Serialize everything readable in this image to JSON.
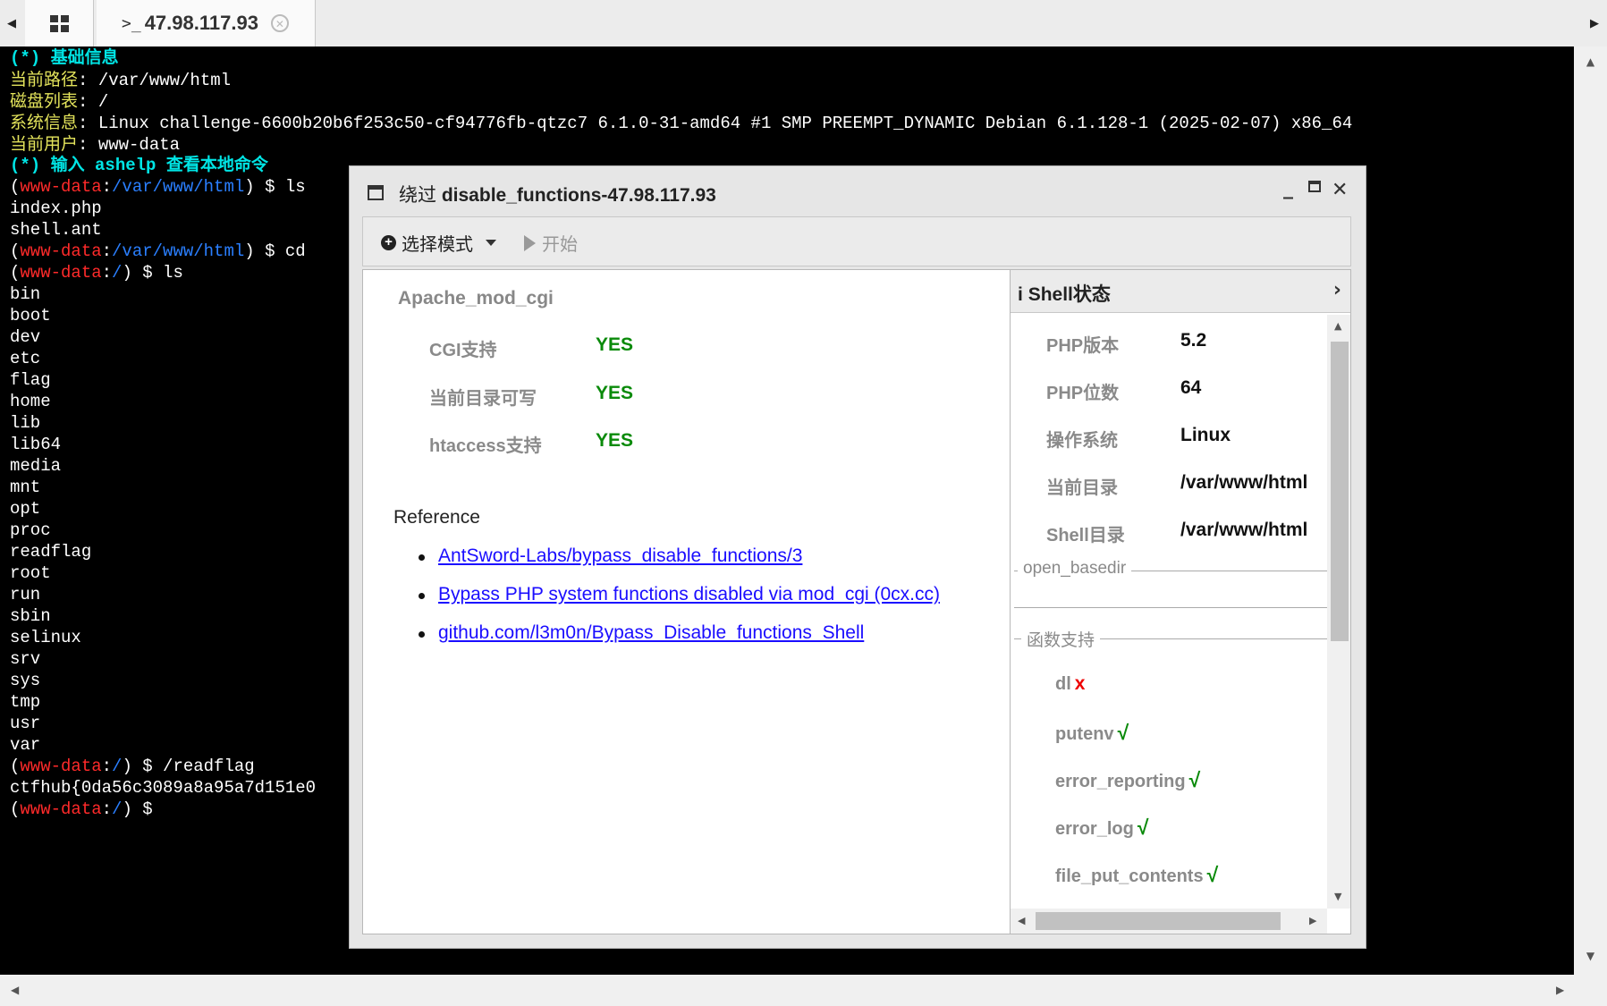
{
  "tabbar": {
    "tab_host": "47.98.117.93",
    "tab_prompt_glyph": ">_"
  },
  "terminal": {
    "lines": [
      [
        {
          "t": "(*) 基础信息",
          "c": "cy"
        }
      ],
      [
        {
          "t": "当前路径",
          "c": "yl"
        },
        {
          "t": ": /var/www/html",
          "c": ""
        }
      ],
      [
        {
          "t": "磁盘列表",
          "c": "yl"
        },
        {
          "t": ": /",
          "c": ""
        }
      ],
      [
        {
          "t": "系统信息",
          "c": "yl"
        },
        {
          "t": ": Linux challenge-6600b20b6f253c50-cf94776fb-qtzc7 6.1.0-31-amd64 #1 SMP PREEMPT_DYNAMIC Debian 6.1.128-1 (2025-02-07) x86_64",
          "c": ""
        }
      ],
      [
        {
          "t": "当前用户",
          "c": "yl"
        },
        {
          "t": ": www-data",
          "c": ""
        }
      ],
      [
        {
          "t": "(*) 输入 ashelp 查看本地命令",
          "c": "cy"
        }
      ],
      [
        {
          "t": "(",
          "c": ""
        },
        {
          "t": "www-data",
          "c": "rd"
        },
        {
          "t": ":",
          "c": ""
        },
        {
          "t": "/var/www/html",
          "c": "bl"
        },
        {
          "t": ") $ ls",
          "c": ""
        }
      ],
      [
        {
          "t": "index.php",
          "c": ""
        }
      ],
      [
        {
          "t": "shell.ant",
          "c": ""
        }
      ],
      [
        {
          "t": "(",
          "c": ""
        },
        {
          "t": "www-data",
          "c": "rd"
        },
        {
          "t": ":",
          "c": ""
        },
        {
          "t": "/var/www/html",
          "c": "bl"
        },
        {
          "t": ") $ cd",
          "c": ""
        }
      ],
      [
        {
          "t": "(",
          "c": ""
        },
        {
          "t": "www-data",
          "c": "rd"
        },
        {
          "t": ":",
          "c": ""
        },
        {
          "t": "/",
          "c": "bl"
        },
        {
          "t": ") $ ls",
          "c": ""
        }
      ],
      [
        {
          "t": "bin",
          "c": ""
        }
      ],
      [
        {
          "t": "boot",
          "c": ""
        }
      ],
      [
        {
          "t": "dev",
          "c": ""
        }
      ],
      [
        {
          "t": "etc",
          "c": ""
        }
      ],
      [
        {
          "t": "flag",
          "c": ""
        }
      ],
      [
        {
          "t": "home",
          "c": ""
        }
      ],
      [
        {
          "t": "lib",
          "c": ""
        }
      ],
      [
        {
          "t": "lib64",
          "c": ""
        }
      ],
      [
        {
          "t": "media",
          "c": ""
        }
      ],
      [
        {
          "t": "mnt",
          "c": ""
        }
      ],
      [
        {
          "t": "opt",
          "c": ""
        }
      ],
      [
        {
          "t": "proc",
          "c": ""
        }
      ],
      [
        {
          "t": "readflag",
          "c": ""
        }
      ],
      [
        {
          "t": "root",
          "c": ""
        }
      ],
      [
        {
          "t": "run",
          "c": ""
        }
      ],
      [
        {
          "t": "sbin",
          "c": ""
        }
      ],
      [
        {
          "t": "selinux",
          "c": ""
        }
      ],
      [
        {
          "t": "srv",
          "c": ""
        }
      ],
      [
        {
          "t": "sys",
          "c": ""
        }
      ],
      [
        {
          "t": "tmp",
          "c": ""
        }
      ],
      [
        {
          "t": "usr",
          "c": ""
        }
      ],
      [
        {
          "t": "var",
          "c": ""
        }
      ],
      [
        {
          "t": "(",
          "c": ""
        },
        {
          "t": "www-data",
          "c": "rd"
        },
        {
          "t": ":",
          "c": ""
        },
        {
          "t": "/",
          "c": "bl"
        },
        {
          "t": ") $ /readflag",
          "c": ""
        }
      ],
      [
        {
          "t": "ctfhub{0da56c3089a8a95a7d151e0",
          "c": ""
        }
      ],
      [
        {
          "t": "(",
          "c": ""
        },
        {
          "t": "www-data",
          "c": "rd"
        },
        {
          "t": ":",
          "c": ""
        },
        {
          "t": "/",
          "c": "bl"
        },
        {
          "t": ") $",
          "c": ""
        }
      ]
    ]
  },
  "modal": {
    "title_prefix": "绕过",
    "title_main": "disable_functions-47.98.117.93",
    "toolbar": {
      "mode_label": "选择模式",
      "start_label": "开始"
    },
    "left": {
      "section_title": "Apache_mod_cgi",
      "checks": [
        {
          "label": "CGI支持",
          "value": "YES"
        },
        {
          "label": "当前目录可写",
          "value": "YES"
        },
        {
          "label": "htaccess支持",
          "value": "YES"
        }
      ],
      "reference_title": "Reference",
      "references": [
        "AntSword-Labs/bypass_disable_functions/3",
        "Bypass PHP system functions disabled via mod_cgi (0cx.cc)",
        "github.com/l3m0n/Bypass_Disable_functions_Shell"
      ]
    },
    "right": {
      "header_icon": "i",
      "header_title": "Shell状态",
      "status": [
        {
          "label": "PHP版本",
          "value": "5.2"
        },
        {
          "label": "PHP位数",
          "value": "64"
        },
        {
          "label": "操作系统",
          "value": "Linux"
        },
        {
          "label": "当前目录",
          "value": "/var/www/html"
        },
        {
          "label": "Shell目录",
          "value": "/var/www/html"
        }
      ],
      "open_basedir_label": "open_basedir",
      "functions_label": "函数支持",
      "functions": [
        {
          "name": "dl",
          "ok": false,
          "mark": "x"
        },
        {
          "name": "putenv",
          "ok": true,
          "mark": "√"
        },
        {
          "name": "error_reporting",
          "ok": true,
          "mark": "√"
        },
        {
          "name": "error_log",
          "ok": true,
          "mark": "√"
        },
        {
          "name": "file_put_contents",
          "ok": true,
          "mark": "√"
        }
      ]
    }
  }
}
